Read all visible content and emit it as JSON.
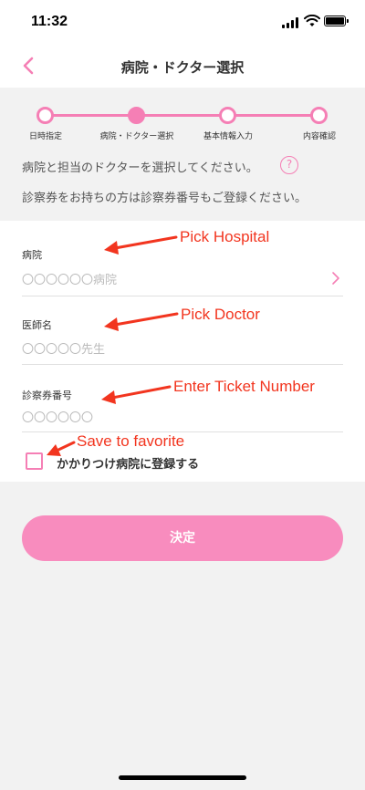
{
  "status_bar": {
    "time": "11:32"
  },
  "nav": {
    "title": "病院・ドクター選択"
  },
  "stepper": {
    "steps": [
      {
        "label": "日時指定",
        "active": false
      },
      {
        "label": "病院・ドクター選択",
        "active": true
      },
      {
        "label": "基本情報入力",
        "active": false
      },
      {
        "label": "内容確認",
        "active": false
      }
    ]
  },
  "instructions": {
    "line1": "病院と担当のドクターを選択してください。",
    "line2": "診察券をお持ちの方は診察券番号もご登録ください。",
    "help_icon_glyph": "?"
  },
  "form": {
    "hospital": {
      "label": "病院",
      "placeholder": "〇〇〇〇〇〇病院"
    },
    "doctor": {
      "label": "医師名",
      "placeholder": "〇〇〇〇〇先生"
    },
    "ticket": {
      "label": "診察券番号",
      "placeholder": "〇〇〇〇〇〇"
    },
    "favorite_label": "かかりつけ病院に登録する"
  },
  "submit_label": "決定",
  "annotations": {
    "pick_hospital": "Pick Hospital",
    "pick_doctor": "Pick Doctor",
    "enter_ticket": "Enter Ticket Number",
    "save_favorite": "Save to favorite"
  },
  "colors": {
    "accent": "#f57fb5",
    "button": "#f88cbe",
    "background_grey": "#f2f2f2",
    "annotation": "#f2351f"
  }
}
